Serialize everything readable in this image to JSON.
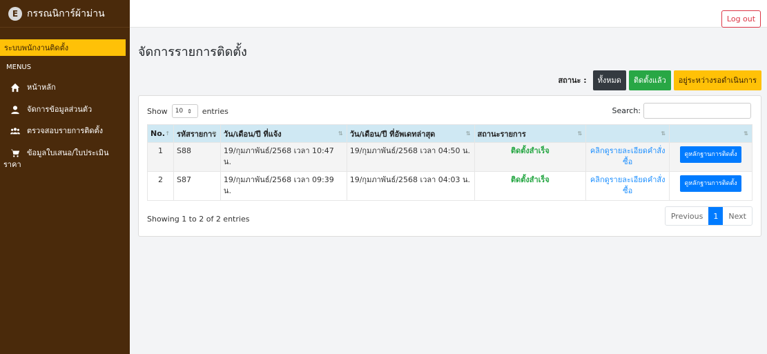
{
  "app": {
    "brand_letter": "E",
    "brand_name": "กรรณนิการ์ผ้าม่าน"
  },
  "sidebar": {
    "active_label": "ระบบพนักงานติดตั้ง",
    "menus_label": "MENUS",
    "items": [
      {
        "label": "หน้าหลัก",
        "icon": "home-icon"
      },
      {
        "label": "จัดการข้อมูลส่วนตัว",
        "icon": "user-icon"
      },
      {
        "label": "ตรวจสอบรายการติดตั้ง",
        "icon": "users-icon"
      },
      {
        "label": "ข้อมูลใบเสนอ/ใบประเมิน",
        "label2": "ราคา",
        "icon": "cart-icon"
      }
    ]
  },
  "topbar": {
    "logout_label": "Log out"
  },
  "page": {
    "title": "จัดการรายการติดตั้ง"
  },
  "status_filter": {
    "label": "สถานะ :",
    "all": "ทั้งหมด",
    "done": "ติดตั้งแล้ว",
    "pending": "อยู่ระหว่างรอดำเนินการ"
  },
  "table_controls": {
    "show": "Show",
    "page_size": "10",
    "entries": "entries",
    "search_label": "Search:",
    "search_value": ""
  },
  "table": {
    "headers": [
      "No.",
      "รหัสรายการ",
      "วัน/เดือน/ปี ที่แจ้ง",
      "วัน/เดือน/ปี ที่อัพเดทล่าสุด",
      "สถานะรายการ",
      "",
      ""
    ],
    "rows": [
      {
        "no": "1",
        "code": "S88",
        "reported": "19/กุมภาพันธ์/2568 เวลา 10:47 น.",
        "updated": "19/กุมภาพันธ์/2568 เวลา 04:50 น.",
        "status": "ติดตั้งสำเร็จ",
        "detail_link": "คลิกดูรายละเอียดคำสั่งซื้อ",
        "evidence_btn": "ดูหลักฐานการติดตั้ง"
      },
      {
        "no": "2",
        "code": "S87",
        "reported": "19/กุมภาพันธ์/2568 เวลา 09:39 น.",
        "updated": "19/กุมภาพันธ์/2568 เวลา 04:03 น.",
        "status": "ติดตั้งสำเร็จ",
        "detail_link": "คลิกดูรายละเอียดคำสั่งซื้อ",
        "evidence_btn": "ดูหลักฐานการติดตั้ง"
      }
    ]
  },
  "footer": {
    "showing": "Showing 1 to 2 of 2 entries",
    "previous": "Previous",
    "current_page": "1",
    "next": "Next"
  },
  "colors": {
    "sidebar": "#4a2a0b",
    "accent": "#ffc107",
    "success": "#28a745",
    "primary": "#007bff",
    "danger": "#dc3545"
  }
}
